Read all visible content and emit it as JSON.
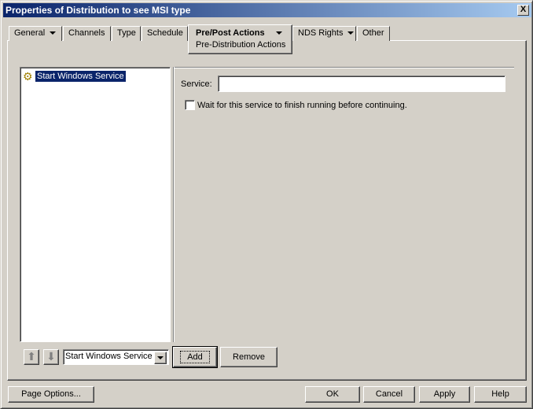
{
  "window": {
    "title": "Properties of Distribution to see MSI type",
    "close": "X"
  },
  "tabs": [
    {
      "label": "General",
      "dropdown": true
    },
    {
      "label": "Channels"
    },
    {
      "label": "Type"
    },
    {
      "label": "Schedule"
    },
    {
      "label": "Pre/Post Actions",
      "dropdown": true,
      "active": true,
      "subtitle": "Pre-Distribution Actions"
    },
    {
      "label": "NDS Rights",
      "dropdown": true
    },
    {
      "label": "Other"
    }
  ],
  "actions_list": {
    "items": [
      {
        "label": "Start Windows Service",
        "icon": "gear-icon",
        "selected": true
      }
    ]
  },
  "details": {
    "service_label": "Service:",
    "service_value": "",
    "wait_checkbox_label": "Wait for this service to finish running before continuing.",
    "wait_checked": false
  },
  "controls": {
    "action_type": "Start Windows Service",
    "add": "Add",
    "remove": "Remove"
  },
  "footer": {
    "page_options": "Page Options...",
    "ok": "OK",
    "cancel": "Cancel",
    "apply": "Apply",
    "help": "Help"
  }
}
